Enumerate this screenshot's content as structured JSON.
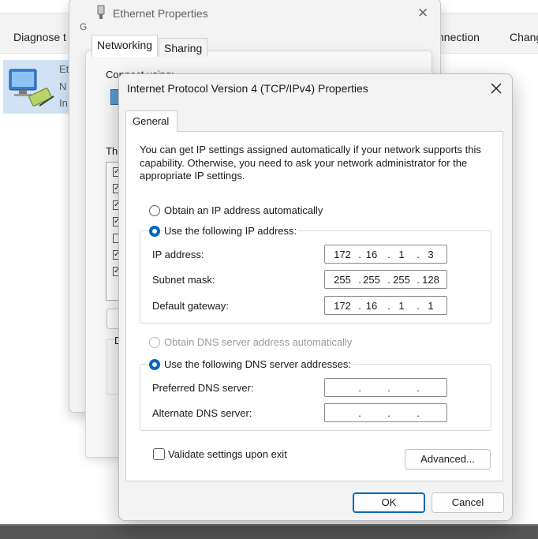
{
  "background_window": {
    "toolbar": {
      "diagnose_label": "Diagnose t",
      "connection_label": "nnection",
      "change_label": "Chang"
    },
    "adapter": {
      "name_fragment": "Et",
      "line2_fragment": "N",
      "line3_fragment": "In"
    }
  },
  "ethernet_properties": {
    "title": "Ethernet Properties",
    "close_glyph": "✕",
    "tabs": [
      "Networking",
      "Sharing"
    ],
    "side_fragment_g": "G",
    "connect_using_label": "Connect using:",
    "this_connection_fragment": "Thi",
    "d_fragment": "D",
    "component_checks": [
      true,
      true,
      true,
      true,
      false,
      true,
      true
    ]
  },
  "ipv4_dialog": {
    "title": "Internet Protocol Version 4 (TCP/IPv4) Properties",
    "close_glyph": "✕",
    "tab_general": "General",
    "intro_text": "You can get IP settings assigned automatically if your network supports this capability. Otherwise, you need to ask your network administrator for the appropriate IP settings.",
    "ip_auto_label": "Obtain an IP address automatically",
    "ip_manual_label": "Use the following IP address:",
    "ip_address_label": "IP address:",
    "ip_address": [
      "172",
      "16",
      "1",
      "3"
    ],
    "subnet_mask_label": "Subnet mask:",
    "subnet_mask": [
      "255",
      "255",
      "255",
      "128"
    ],
    "gateway_label": "Default gateway:",
    "gateway": [
      "172",
      "16",
      "1",
      "1"
    ],
    "dns_auto_label": "Obtain DNS server address automatically",
    "dns_manual_label": "Use the following DNS server addresses:",
    "preferred_dns_label": "Preferred DNS server:",
    "alternate_dns_label": "Alternate DNS server:",
    "validate_label": "Validate settings upon exit",
    "advanced_button": "Advanced...",
    "ok_button": "OK",
    "cancel_button": "Cancel",
    "accent_color": "#0067c0"
  }
}
